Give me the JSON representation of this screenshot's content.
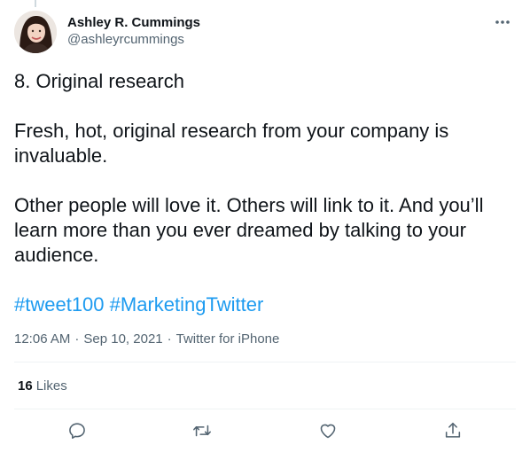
{
  "author": {
    "display_name": "Ashley R. Cummings",
    "handle": "@ashleyrcummings",
    "avatar_icon": "profile-photo"
  },
  "tweet": {
    "heading": "8. Original research",
    "paragraph_1": "Fresh, hot, original research from your company is invaluable.",
    "paragraph_2": "Other people will love it. Others will link to it. And you’ll learn more than you ever dreamed by talking to your audience.",
    "hashtags": [
      "#tweet100",
      "#MarketingTwitter"
    ]
  },
  "meta": {
    "time": "12:06 AM",
    "separator": "·",
    "date": "Sep 10, 2021",
    "source": "Twitter for iPhone"
  },
  "stats": {
    "likes_count": "16",
    "likes_label": "Likes"
  },
  "icons": {
    "more": "more-horizontal-icon",
    "reply": "reply-icon",
    "retweet": "retweet-icon",
    "like": "heart-icon",
    "share": "share-icon"
  },
  "colors": {
    "text": "#0f1419",
    "secondary": "#536471",
    "link": "#1d9bf0",
    "divider": "#eff3f4"
  }
}
